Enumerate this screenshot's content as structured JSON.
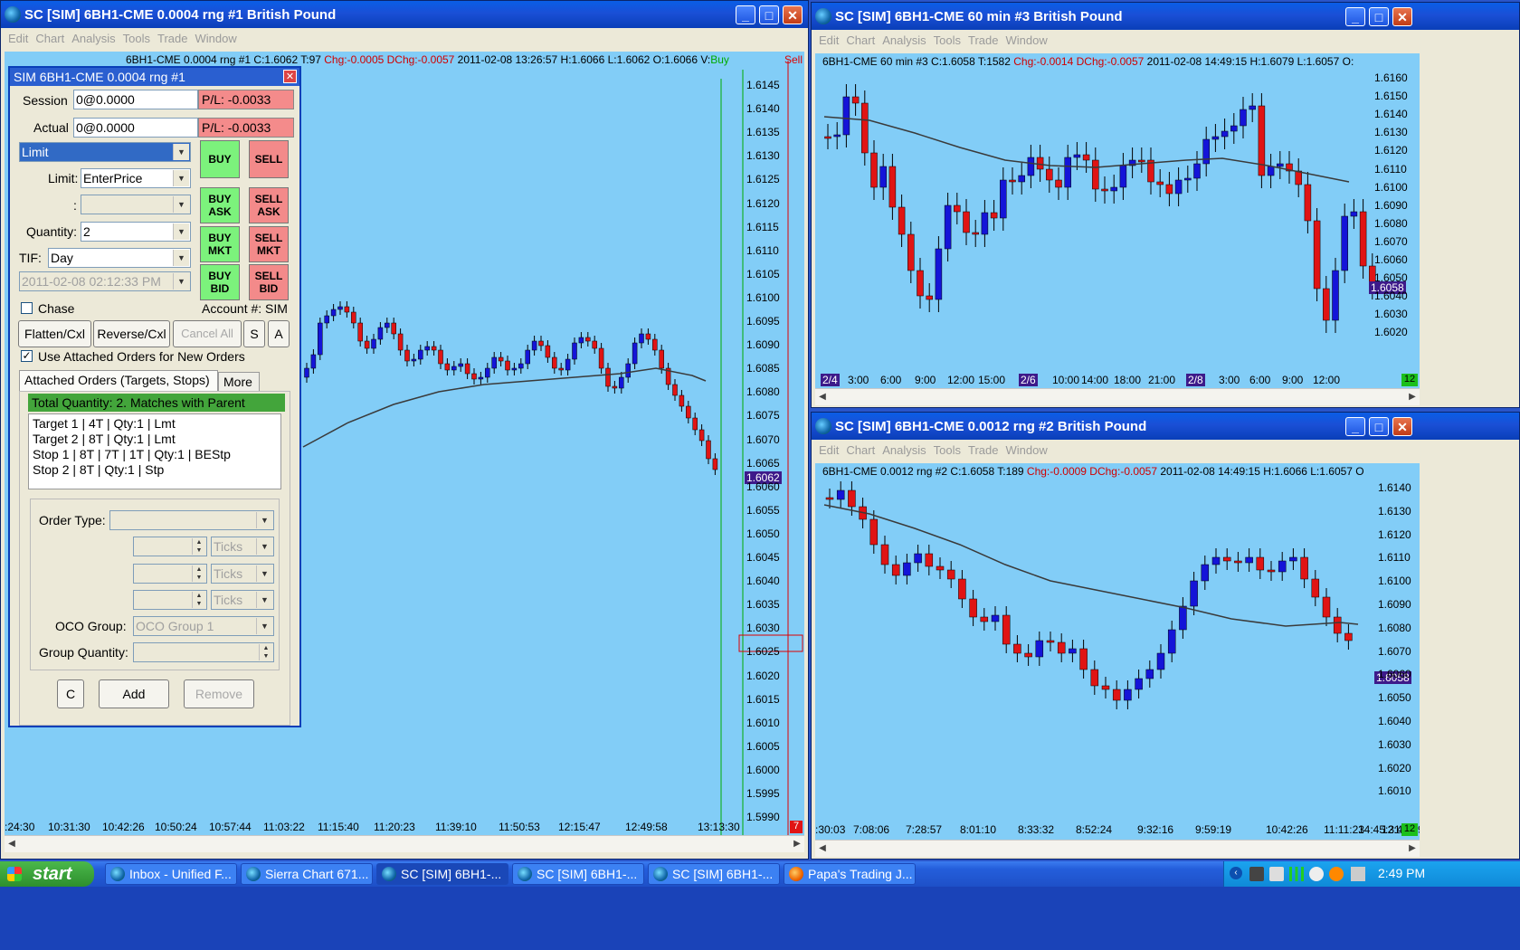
{
  "win1": {
    "title": "SC [SIM] 6BH1-CME  0.0004 rng  #1  British Pound",
    "menu": [
      "Edit",
      "Chart",
      "Analysis",
      "Tools",
      "Trade",
      "Window"
    ],
    "header_main": "6BH1-CME  0.0004 rng  #1  C:1.6062 T:97 ",
    "header_chg": "Chg:-0.0005 DChg:-0.0057",
    "header_rest": " 2011-02-08 13:26:57 H:1.6066 L:1.6062 O:1.6066 V:",
    "buy_label": "Buy",
    "sell_label": "Sell",
    "price_tag": "1.6062",
    "y_labels": [
      "1.6145",
      "1.6140",
      "1.6135",
      "1.6130",
      "1.6125",
      "1.6120",
      "1.6115",
      "1.6110",
      "1.6105",
      "1.6100",
      "1.6095",
      "1.6090",
      "1.6085",
      "1.6080",
      "1.6075",
      "1.6070",
      "1.6065",
      "1.6060",
      "1.6055",
      "1.6050",
      "1.6045",
      "1.6040",
      "1.6035",
      "1.6030",
      "1.6025",
      "1.6020",
      "1.6015",
      "1.6010",
      "1.6005",
      "1.6000",
      "1.5995",
      "1.5990"
    ],
    "x_labels": [
      ":24:30",
      "10:31:30",
      "10:42:26",
      "10:50:24",
      "10:57:44",
      "11:03:22",
      "11:15:40",
      "11:20:23",
      "11:39:10",
      "11:50:53",
      "12:15:47",
      "12:49:58",
      "13:13:30"
    ],
    "red_square": "7"
  },
  "panel": {
    "title": "SIM 6BH1-CME  0.0004 rng  #1",
    "session_label": "Session",
    "session_value": "0@0.0000",
    "session_pl": "P/L: -0.0033",
    "actual_label": "Actual",
    "actual_value": "0@0.0000",
    "actual_pl": "P/L: -0.0033",
    "order_type": "Limit",
    "limit_label": "Limit:",
    "limit_value": "EnterPrice",
    "colon_label": ":",
    "quantity_label": "Quantity:",
    "quantity_value": "2",
    "tif_label": "TIF:",
    "tif_value": "Day",
    "date_value": "2011-02-08 02:12:33 PM",
    "buy": "BUY",
    "sell": "SELL",
    "buy_ask": "BUY ASK",
    "sell_ask": "SELL ASK",
    "buy_mkt": "BUY MKT",
    "sell_mkt": "SELL MKT",
    "buy_bid": "BUY BID",
    "sell_bid": "SELL BID",
    "chase": "Chase",
    "account": "Account #: SIM",
    "flatten": "Flatten/Cxl",
    "reverse": "Reverse/Cxl",
    "cancel_all": "Cancel All",
    "s": "S",
    "a": "A",
    "use_attached": "Use Attached Orders for New Orders",
    "tab_attached": "Attached Orders (Targets, Stops)",
    "tab_more": "More",
    "total_qty": "Total Quantity: 2. Matches with Parent",
    "attached_items": [
      "Target 1 | 4T | Qty:1 | Lmt",
      "Target 2 | 8T | Qty:1 | Lmt",
      "Stop 1 | 8T | 7T | 1T | Qty:1 | BEStp",
      "Stop 2 | 8T | Qty:1 | Stp"
    ],
    "order_type_label": "Order Type:",
    "ticks": "Ticks",
    "oco_label": "OCO Group:",
    "oco_value": "OCO Group 1",
    "group_qty_label": "Group Quantity:",
    "c": "C",
    "add": "Add",
    "remove": "Remove"
  },
  "win3": {
    "title": "SC [SIM] 6BH1-CME  60 min   #3  British Pound",
    "menu": [
      "Edit",
      "Chart",
      "Analysis",
      "Tools",
      "Trade",
      "Window"
    ],
    "header_main": "6BH1-CME  60 min   #3 C:1.6058 T:1582 ",
    "header_chg": "Chg:-0.0014 DChg:-0.0057",
    "header_rest": " 2011-02-08 14:49:15 H:1.6079 L:1.6057 O:",
    "y_labels": [
      "1.6160",
      "1.6150",
      "1.6140",
      "1.6130",
      "1.6120",
      "1.6110",
      "1.6100",
      "1.6090",
      "1.6080",
      "1.6070",
      "1.6060",
      "1.6050",
      "1.6040",
      "1.6030",
      "1.6020"
    ],
    "price_tag": "1.6058",
    "date_tags": [
      "2/4",
      "2/6",
      "2/8"
    ],
    "x_labels": [
      "3:00",
      "6:00",
      "9:00",
      "12:00",
      "15:00",
      "10:00",
      "14:00",
      "18:00",
      "21:00",
      "3:00",
      "6:00",
      "9:00",
      "12:00"
    ],
    "green_square": "12"
  },
  "win2": {
    "title": "SC [SIM] 6BH1-CME  0.0012 rng  #2  British Pound",
    "menu": [
      "Edit",
      "Chart",
      "Analysis",
      "Tools",
      "Trade",
      "Window"
    ],
    "header_main": "6BH1-CME  0.0012 rng  #2 C:1.6058 T:189 ",
    "header_chg": "Chg:-0.0009 DChg:-0.0057",
    "header_rest": " 2011-02-08 14:49:15 H:1.6066 L:1.6057 O",
    "y_labels": [
      "1.6140",
      "1.6130",
      "1.6120",
      "1.6110",
      "1.6100",
      "1.6090",
      "1.6080",
      "1.6070",
      "1.6060",
      "1.6050",
      "1.6040",
      "1.6030",
      "1.6020",
      "1.6010"
    ],
    "price_tag": "1.6058",
    "x_labels": [
      ":30:03",
      "7:08:06",
      "7:28:57",
      "8:01:10",
      "8:33:32",
      "8:52:24",
      "9:32:16",
      "9:59:19",
      "10:42:26",
      "11:11:23",
      "12:41:29",
      "14:45:31"
    ],
    "green_square": "12"
  },
  "taskbar": {
    "start": "start",
    "tasks": [
      "Inbox - Unified F...",
      "Sierra Chart 671...",
      "SC [SIM] 6BH1-...",
      "SC [SIM] 6BH1-...",
      "SC [SIM] 6BH1-...",
      "Papa's Trading J..."
    ],
    "clock": "2:49 PM"
  },
  "colors": {
    "chart_bg": "#82cdf7",
    "up": "#1414d8",
    "down": "#e01414",
    "ma": "#3a3a3a",
    "buy": "#7cf27c",
    "sell": "#f38a8a"
  }
}
